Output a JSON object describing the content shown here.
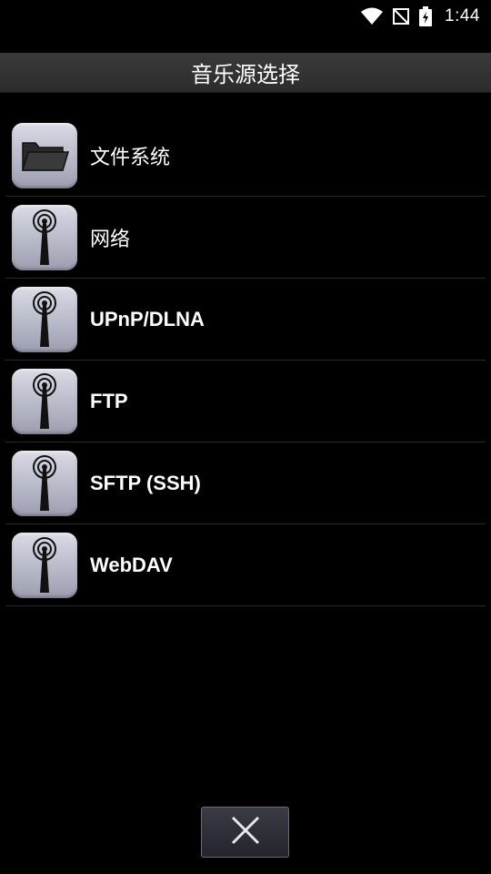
{
  "status_bar": {
    "time": "1:44",
    "icons": [
      "wifi-icon",
      "no-signal-icon",
      "battery-charging-icon"
    ]
  },
  "header": {
    "title": "音乐源选择"
  },
  "sources": [
    {
      "label": "文件系统",
      "icon": "folder-icon"
    },
    {
      "label": "网络",
      "icon": "antenna-icon"
    },
    {
      "label": "UPnP/DLNA",
      "icon": "antenna-icon"
    },
    {
      "label": "FTP",
      "icon": "antenna-icon"
    },
    {
      "label": "SFTP (SSH)",
      "icon": "antenna-icon"
    },
    {
      "label": "WebDAV",
      "icon": "antenna-icon"
    }
  ],
  "footer": {
    "close_icon": "close-icon"
  }
}
